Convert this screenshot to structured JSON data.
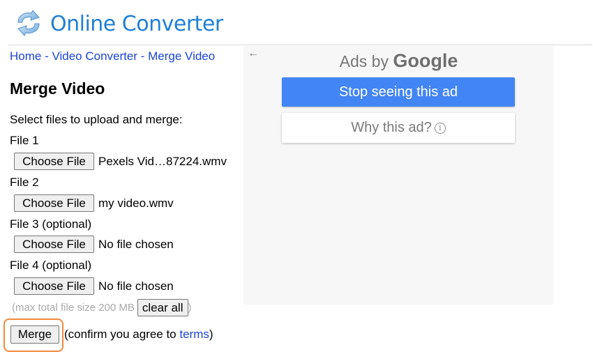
{
  "header": {
    "logo_icon": "refresh-arrows-icon",
    "site_title": "Online Converter"
  },
  "breadcrumb": {
    "items": [
      "Home",
      "Video Converter",
      "Merge Video"
    ],
    "separator": " - "
  },
  "page": {
    "title": "Merge Video",
    "intro": "Select files to upload and merge:"
  },
  "files": [
    {
      "label": "File 1",
      "button": "Choose File",
      "value": "Pexels Vid…87224.wmv"
    },
    {
      "label": "File 2",
      "button": "Choose File",
      "value": "my video.wmv"
    },
    {
      "label": "File 3 (optional)",
      "button": "Choose File",
      "value": "No file chosen"
    },
    {
      "label": "File 4 (optional)",
      "button": "Choose File",
      "value": "No file chosen"
    }
  ],
  "limits": {
    "note": "(max total file size 200 MB",
    "clear_label": "clear all",
    "close_paren": ")"
  },
  "actions": {
    "merge_label": "Merge",
    "confirm_prefix": "(confirm you agree to ",
    "terms_link": "terms",
    "confirm_suffix": ")"
  },
  "ad": {
    "back_icon": "←",
    "ads_by": "Ads by",
    "google": "Google",
    "stop_label": "Stop seeing this ad",
    "why_label": "Why this ad?",
    "info_icon": "i"
  },
  "colors": {
    "brand": "#1e7fd6",
    "link": "#1a44d8",
    "ad_button": "#4285f4",
    "highlight": "#f08a3a"
  }
}
